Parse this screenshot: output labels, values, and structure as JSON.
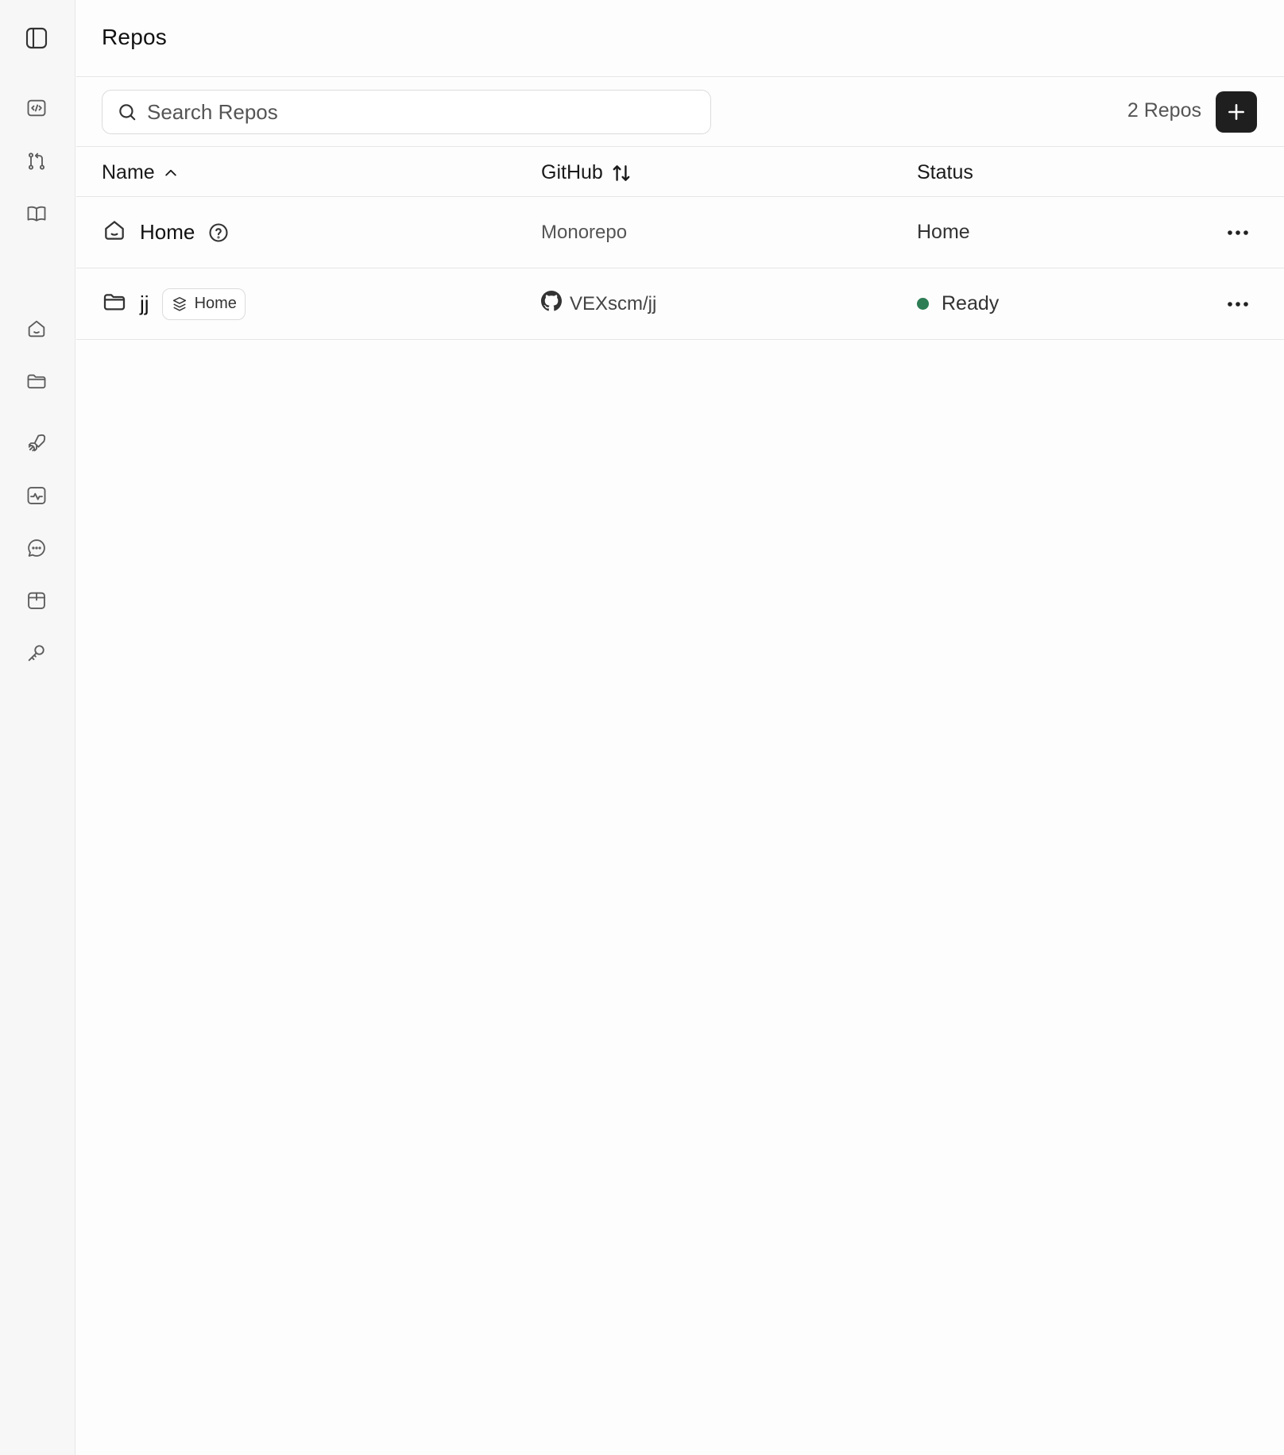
{
  "header": {
    "title": "Repos"
  },
  "sidebar": {
    "toggle_icon": "sidebar-toggle-icon",
    "items": [
      {
        "icon": "code-icon"
      },
      {
        "icon": "git-pull-request-icon"
      },
      {
        "icon": "book-icon"
      },
      {
        "icon": "home-icon"
      },
      {
        "icon": "folder-icon"
      },
      {
        "icon": "rocket-icon"
      },
      {
        "icon": "activity-icon"
      },
      {
        "icon": "chat-icon"
      },
      {
        "icon": "package-icon"
      },
      {
        "icon": "key-icon"
      }
    ]
  },
  "toolbar": {
    "search_placeholder": "Search Repos",
    "search_value": "",
    "count_label": "2 Repos",
    "add_icon": "plus-icon"
  },
  "table": {
    "columns": {
      "name": "Name",
      "github": "GitHub",
      "status": "Status"
    },
    "rows": [
      {
        "icon": "home-icon",
        "name": "Home",
        "has_help": true,
        "github": "Monorepo",
        "status": "Home"
      },
      {
        "icon": "folder-icon",
        "name": "jj",
        "badge": "Home",
        "github": "VEXscm/jj",
        "status": "Ready",
        "status_color": "#2e7d55"
      }
    ]
  }
}
